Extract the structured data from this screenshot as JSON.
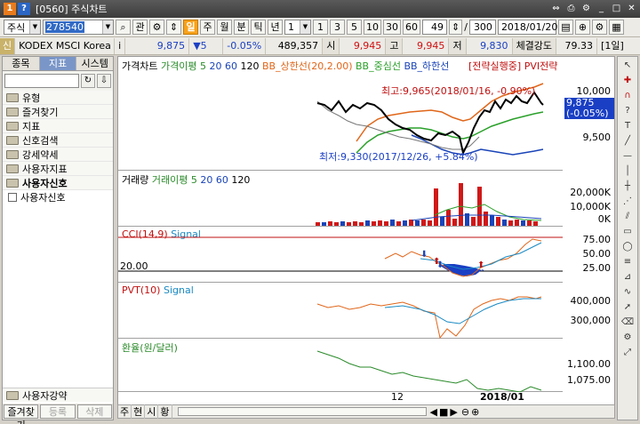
{
  "window": {
    "title": "[0560] 주식차트",
    "logo_text": "1",
    "help_text": "?"
  },
  "toolbar": {
    "market": "주식",
    "code": "278540",
    "search_icon": "search-icon",
    "lookup_label": "관",
    "buttons": [
      "일",
      "주",
      "월",
      "분",
      "틱",
      "년"
    ],
    "interval_value": "1",
    "periods": [
      "1",
      "3",
      "5",
      "10",
      "30",
      "60"
    ],
    "count_value": "49",
    "total_value": "300",
    "slash": "/",
    "date_value": "2018/01/20"
  },
  "quote": {
    "badge": "신",
    "name": "KODEX MSCI Korea T",
    "info_icon": "i",
    "price": "9,875",
    "change": "▼5",
    "change_pct": "-0.05%",
    "volume": "489,357",
    "open_label": "시",
    "open": "9,945",
    "high_label": "고",
    "high": "9,945",
    "low_label": "저",
    "low": "9,830",
    "strength_label": "체결강도",
    "strength": "79.33",
    "period_label": "[1일]"
  },
  "left_panel": {
    "tabs": [
      "종목",
      "지표",
      "시스템"
    ],
    "active_tab": 1,
    "folders": [
      "유형",
      "즐겨찾기",
      "지표",
      "신호검색",
      "강세약세",
      "사용자지표",
      "사용자신호"
    ],
    "subitem": "사용자신호",
    "bottom_folder": "사용자강약",
    "bottom_tabs": [
      "즐겨찾기",
      "등록",
      "삭제"
    ]
  },
  "panes": {
    "price": {
      "legend": [
        "가격차트",
        "가격이평 5",
        "20",
        "60",
        "120",
        "BB_상한선(20,2.00)",
        "BB_중심선",
        "BB_하한선",
        "[전략실행중]",
        "PVI전략"
      ],
      "high_note": "최고:9,965(2018/01/16, -0.90%)",
      "low_note": "최저:9,330(2017/12/26, +5.84%)",
      "y_labels": [
        "10,000",
        "9,500"
      ],
      "current_price": "9,875",
      "current_pct": "(-0.05%)"
    },
    "volume": {
      "legend": [
        "거래량",
        "거래이평 5",
        "20",
        "60",
        "120"
      ],
      "y_labels": [
        "20,000K",
        "10,000K",
        "0K"
      ]
    },
    "stoch": {
      "legend": [
        "CCI(14,9)",
        "Signal"
      ],
      "level": "20.00",
      "y_labels": [
        "75.00",
        "50.00",
        "25.00"
      ]
    },
    "pvt": {
      "legend": [
        "PVT(10)",
        "Signal"
      ],
      "y_labels": [
        "400,000",
        "300,000"
      ]
    },
    "fx": {
      "legend": [
        "환율(원/달러)"
      ],
      "y_labels": [
        "1,100.00",
        "1,075.00"
      ]
    }
  },
  "x_axis": {
    "labels": [
      "12",
      "2018/01"
    ]
  },
  "bottom_bar": {
    "tabs": [
      "주",
      "현",
      "시",
      "황"
    ]
  },
  "colors": {
    "bb_upper": "#e0661a",
    "bb_mid": "#2aa02a",
    "bb_lower": "#1a44b8",
    "price_line": "#000000",
    "volume_bar_up": "#d01818",
    "volume_bar_down": "#1a44b8"
  }
}
